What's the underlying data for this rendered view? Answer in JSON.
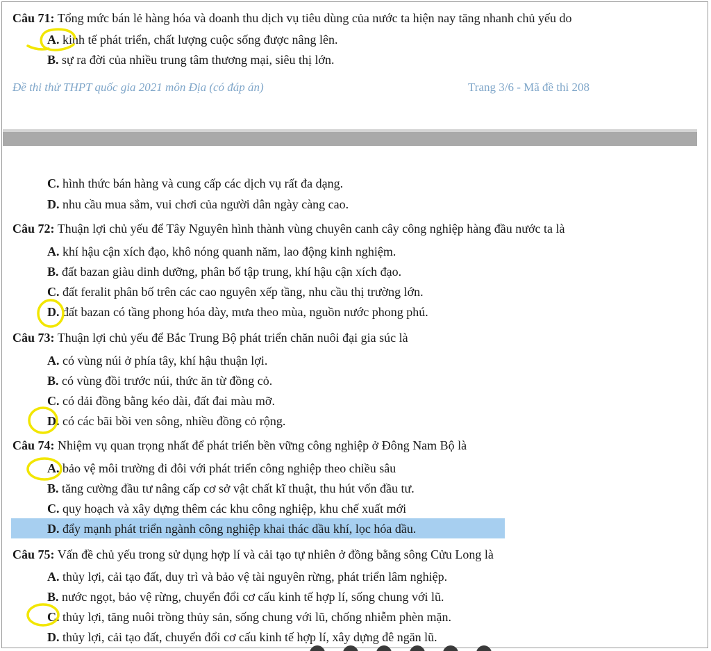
{
  "page_top": {
    "q71": {
      "num": "Câu 71:",
      "text": " Tổng mức bán lẻ hàng hóa và doanh thu dịch vụ tiêu dùng của nước ta hiện nay tăng nhanh chủ yếu do"
    },
    "q71_a": {
      "letter": "A.",
      "text": " kinh tế phát triển, chất lượng cuộc sống được nâng lên."
    },
    "q71_b": {
      "letter": "B.",
      "text": " sự ra đời của nhiều trung tâm thương mại, siêu thị lớn."
    }
  },
  "footer": {
    "left": "Đề thi thử THPT quốc gia 2021 môn Địa (có đáp án)",
    "right": "Trang 3/6 - Mã đề thi 208"
  },
  "page_bottom": {
    "q71_c": {
      "letter": "C.",
      "text": " hình thức bán hàng và cung cấp các dịch vụ rất đa dạng."
    },
    "q71_d": {
      "letter": "D.",
      "text": " nhu cầu mua sắm, vui chơi của người dân ngày càng cao."
    },
    "q72": {
      "num": "Câu 72:",
      "text": " Thuận lợi chủ yếu để Tây Nguyên hình thành vùng chuyên canh cây công nghiệp hàng đầu nước ta là"
    },
    "q72_a": {
      "letter": "A.",
      "text": " khí hậu cận xích đạo, khô nóng quanh năm, lao động kinh nghiệm."
    },
    "q72_b": {
      "letter": "B.",
      "text": " đất bazan giàu dinh dưỡng, phân bố tập trung, khí hậu cận xích đạo."
    },
    "q72_c": {
      "letter": "C.",
      "text": " đất feralit phân bố trên các cao nguyên xếp tầng, nhu cầu thị trường lớn."
    },
    "q72_d": {
      "letter": "D.",
      "text": " đất bazan có tầng phong hóa dày, mưa theo mùa, nguồn nước phong  phú."
    },
    "q73": {
      "num": "Câu 73:",
      "text": " Thuận lợi chủ yếu để Bắc Trung Bộ phát triển chăn nuôi đại gia súc là"
    },
    "q73_a": {
      "letter": "A.",
      "text": " có vùng núi ở phía tây, khí hậu thuận lợi."
    },
    "q73_b": {
      "letter": "B.",
      "text": " có vùng đồi trước núi, thức ăn từ đồng cỏ."
    },
    "q73_c": {
      "letter": "C.",
      "text": " có dải đồng bằng kéo dài, đất đai màu mỡ."
    },
    "q73_d": {
      "letter": "D.",
      "text": " có các bãi bồi ven sông, nhiều đồng cỏ rộng."
    },
    "q74": {
      "num": "Câu 74:",
      "text": " Nhiệm vụ quan trọng nhất để phát triển bền vững công nghiệp ở Đông Nam Bộ là"
    },
    "q74_a": {
      "letter": "A.",
      "text": " bảo vệ môi trường đi đôi với phát triển công nghiệp theo chiều sâu"
    },
    "q74_b": {
      "letter": "B.",
      "text": " tăng cường đầu tư nâng cấp cơ sở vật chất kĩ thuật, thu hút vốn đầu tư."
    },
    "q74_c": {
      "letter": "C.",
      "text": " quy hoạch và xây dựng thêm các khu công nghiệp, khu chế xuất mới"
    },
    "q74_d": {
      "letter": "D.",
      "text": " đẩy mạnh phát triển ngành công nghiệp khai thác dầu khí, lọc hóa dầu."
    },
    "q75": {
      "num": "Câu 75:",
      "text": " Vấn đề chủ yếu trong sử dụng hợp lí và cải tạo tự nhiên ở đồng bằng sông Cửu Long là"
    },
    "q75_a": {
      "letter": "A.",
      "text": " thủy lợi, cải tạo đất, duy trì và bảo vệ tài nguyên rừng, phát triển lâm nghiệp."
    },
    "q75_b": {
      "letter": "B.",
      "text": " nước ngọt, bảo vệ rừng, chuyển đổi cơ cấu kinh tế hợp lí, sống chung với lũ."
    },
    "q75_c": {
      "letter": "C.",
      "text": " thủy lợi, tăng nuôi trồng thủy sản, sống chung với lũ, chống nhiễm phèn mặn."
    },
    "q75_d": {
      "letter": "D.",
      "text": " thủy lợi, cải tạo đất, chuyển đổi cơ cấu kinh tế hợp lí, xây dựng đê ngăn lũ."
    }
  },
  "annotation_color": "#f2e600",
  "highlight_color": "#a7cff0"
}
